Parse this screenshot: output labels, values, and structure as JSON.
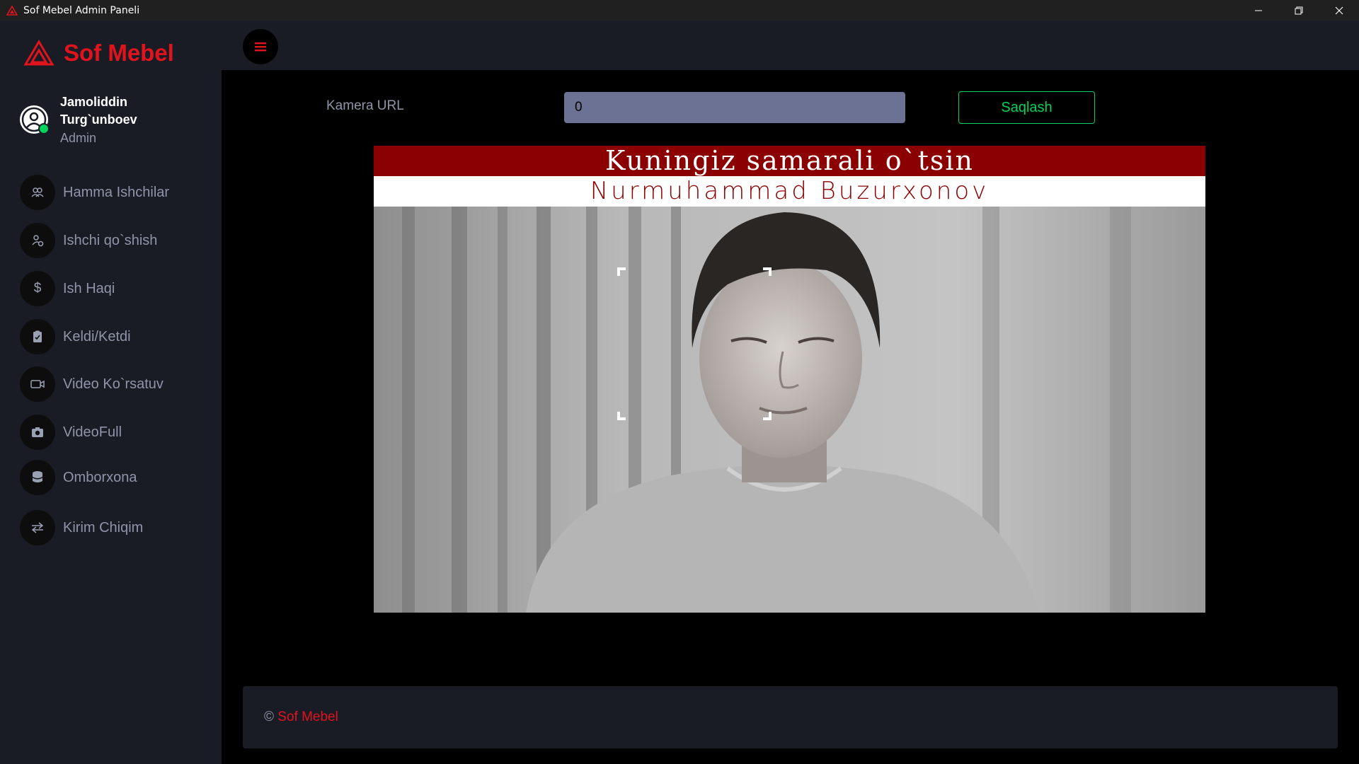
{
  "window": {
    "title": "Sof Mebel Admin Paneli",
    "controls": [
      "minimize-icon",
      "restore-icon",
      "close-icon"
    ]
  },
  "brand": {
    "name": "Sof Mebel",
    "color": "#e1141e"
  },
  "profile": {
    "name": "Jamoliddin Turg`unboev",
    "role": "Admin",
    "status_color": "#00d25b"
  },
  "sidebar": {
    "items": [
      {
        "label": "Hamma Ishchilar",
        "icon": "users-icon"
      },
      {
        "label": "Ishchi qo`shish",
        "icon": "user-add-icon"
      },
      {
        "label": "Ish Haqi",
        "icon": "dollar-icon"
      },
      {
        "label": "Keldi/Ketdi",
        "icon": "clipboard-icon"
      },
      {
        "label": "Video Ko`rsatuv",
        "icon": "video-camera-icon"
      },
      {
        "label": "VideoFull",
        "icon": "camera-icon"
      },
      {
        "label": "Omborxona",
        "icon": "database-icon"
      },
      {
        "label": "Kirim Chiqim",
        "icon": "swap-arrows-icon"
      }
    ]
  },
  "navbar": {
    "menu_icon": "hamburger-icon"
  },
  "camera": {
    "label": "Kamera URL",
    "value": "0",
    "save_label": "Saqlash",
    "save_color": "#00d25b"
  },
  "video": {
    "greeting": "Kuningiz samarali o`tsin",
    "person_name": "Nurmuhammad Buzurxonov",
    "greeting_bg": "#8b0000"
  },
  "footer": {
    "copyright": "©",
    "brand": "Sof Mebel"
  }
}
